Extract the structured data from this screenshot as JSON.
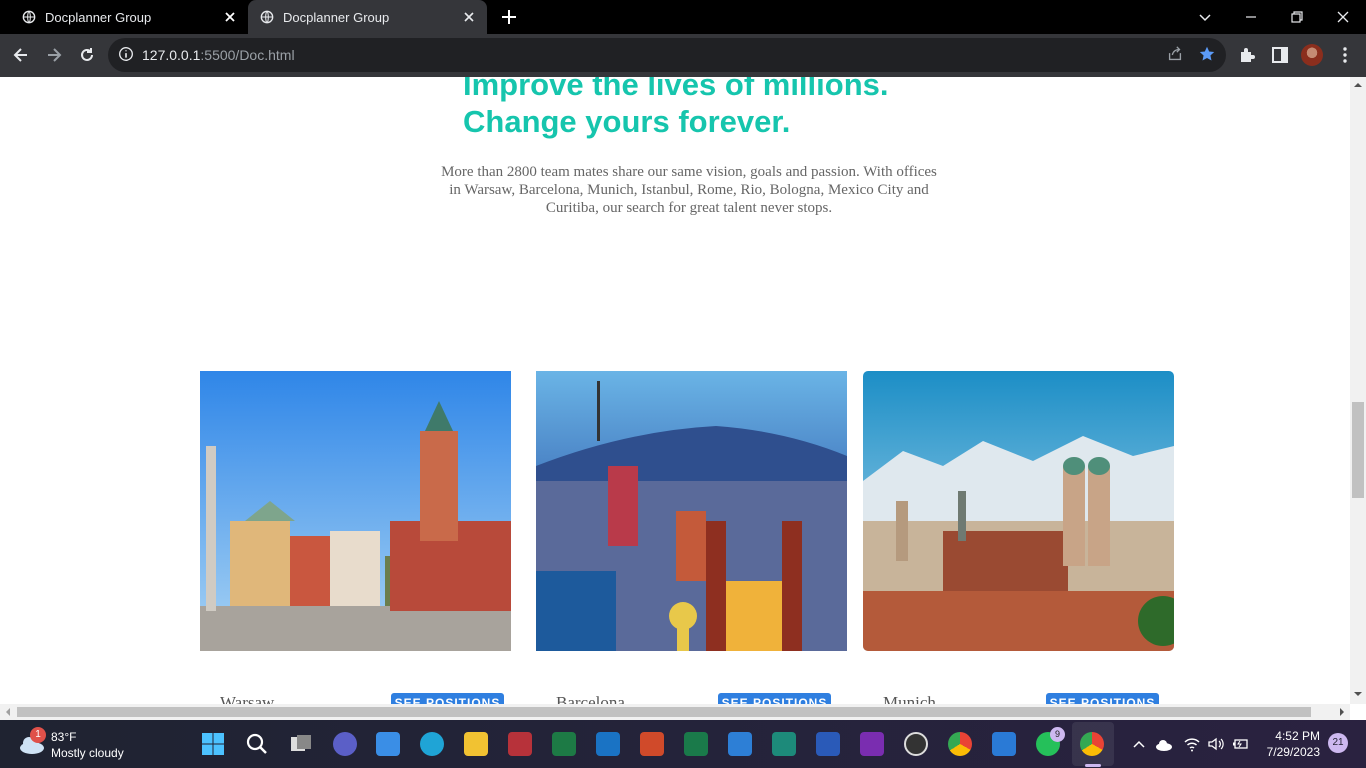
{
  "browser": {
    "tabs": [
      {
        "title": "Docplanner Group"
      },
      {
        "title": "Docplanner Group"
      }
    ],
    "url_host": "127.0.0.1",
    "url_path": ":5500/Doc.html"
  },
  "page": {
    "heading_line1": "Improve the lives of millions.",
    "heading_line2": "Change yours forever.",
    "intro": "More than 2800 team mates share our same vision, goals and passion. With offices in Warsaw, Barcelona, Munich, Istanbul, Rome, Rio, Bologna, Mexico City and Curitiba, our search for great talent never stops.",
    "cities": [
      {
        "name": "Warsaw",
        "button": "SEE POSITIONS"
      },
      {
        "name": "Barcelona",
        "button": "SEE POSITIONS"
      },
      {
        "name": "Munich",
        "button": "SEE POSITIONS"
      }
    ]
  },
  "taskbar": {
    "weather_temp": "83°F",
    "weather_desc": "Mostly cloudy",
    "weather_badge": "1",
    "whatsapp_badge": "9",
    "time": "4:52 PM",
    "date": "7/29/2023",
    "notification_count": "21"
  },
  "colors": {
    "accent": "#16c5ad",
    "button": "#2f7fe0"
  }
}
